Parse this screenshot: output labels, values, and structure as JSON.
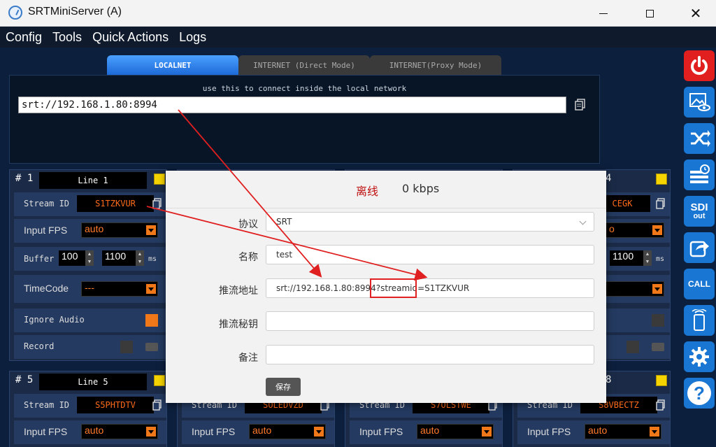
{
  "window": {
    "title": "SRTMiniServer (A)"
  },
  "menu": [
    "Config",
    "Tools",
    "Quick Actions",
    "Logs"
  ],
  "tabs": [
    "LOCALNET",
    "INTERNET (Direct Mode)",
    "INTERNET(Proxy Mode)"
  ],
  "connect": {
    "hint": "use this to connect inside the local network",
    "url": "srt://192.168.1.80:8994"
  },
  "cards": {
    "c1": {
      "num": "# 1",
      "name": "Line 1",
      "stream_label": "Stream ID",
      "stream_id": "S1TZKVUR",
      "fps_label": "Input FPS",
      "fps": "auto",
      "buffer_label": "Buffer",
      "buffer_a": "100",
      "buffer_b": "1100",
      "ms": "ms",
      "timecode_label": "TimeCode",
      "timecode": "---",
      "ignore_audio_label": "Ignore Audio",
      "record_label": "Record"
    },
    "c4": {
      "num": "4",
      "stream_id": "CEGK",
      "fps": "o",
      "buffer_b": "1100",
      "ms": "ms"
    },
    "c5": {
      "num": "# 5",
      "name": "Line 5",
      "stream_label": "Stream ID",
      "stream_id": "S5PHTDTV",
      "fps_label": "Input FPS",
      "fps": "auto"
    },
    "c6": {
      "stream_label": "Stream ID",
      "stream_id": "SOLEDVZD",
      "fps_label": "Input FPS",
      "fps": "auto"
    },
    "c7": {
      "stream_label": "Stream ID",
      "stream_id": "S7OLSTWE",
      "fps_label": "Input FPS",
      "fps": "auto"
    },
    "c8": {
      "num": "8",
      "stream_label": "Stream ID",
      "stream_id": "S8VBECTZ",
      "fps_label": "Input FPS",
      "fps": "auto"
    }
  },
  "sidebar": {
    "sdi_label": "SDI",
    "sdi_sub": "out",
    "call_label": "CALL",
    "help_label": "?"
  },
  "dialog": {
    "status": "离线",
    "rate": "0 kbps",
    "protocol_label": "协议",
    "protocol": "SRT",
    "name_label": "名称",
    "name": "test",
    "push_url_label": "推流地址",
    "push_url": "srt://192.168.1.80:8994?streamid=S1TZKVUR",
    "push_key_label": "推流秘钥",
    "push_key": "",
    "note_label": "备注",
    "note": "",
    "save_label": "保存"
  },
  "colors": {
    "accent": "#1976d2",
    "stream_id": "#ff6a1a",
    "status_offline": "#c01010",
    "annotation": "#e02020"
  }
}
